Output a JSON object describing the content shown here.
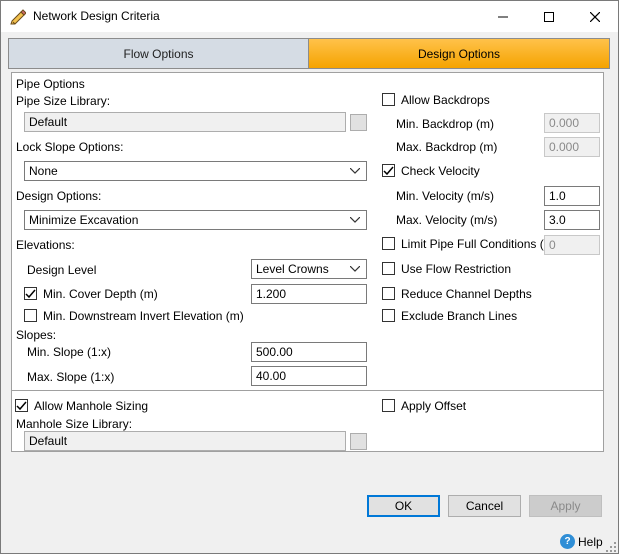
{
  "window": {
    "title": "Network Design Criteria"
  },
  "tabs": {
    "flow": "Flow Options",
    "design": "Design Options",
    "active": "Design Options"
  },
  "pipe_options": {
    "section_label": "Pipe Options",
    "size_library_label": "Pipe Size Library:",
    "size_library_value": "Default",
    "lock_slope_label": "Lock Slope Options:",
    "lock_slope_value": "None",
    "design_options_label": "Design Options:",
    "design_options_value": "Minimize Excavation",
    "elevations_label": "Elevations:",
    "design_level_label": "Design Level",
    "design_level_value": "Level Crowns",
    "min_cover_label": "Min. Cover Depth (m)",
    "min_cover_checked": true,
    "min_cover_value": "1.200",
    "min_ds_invert_label": "Min. Downstream Invert Elevation (m)",
    "min_ds_invert_checked": false,
    "slopes_label": "Slopes:",
    "min_slope_label": "Min. Slope (1:x)",
    "min_slope_value": "500.00",
    "max_slope_label": "Max. Slope (1:x)",
    "max_slope_value": "40.00"
  },
  "right_options": {
    "allow_backdrops_label": "Allow Backdrops",
    "allow_backdrops_checked": false,
    "min_backdrop_label": "Min. Backdrop (m)",
    "min_backdrop_value": "0.000",
    "max_backdrop_label": "Max. Backdrop (m)",
    "max_backdrop_value": "0.000",
    "check_velocity_label": "Check Velocity",
    "check_velocity_checked": true,
    "min_velocity_label": "Min. Velocity (m/s)",
    "min_velocity_value": "1.0",
    "max_velocity_label": "Max. Velocity (m/s)",
    "max_velocity_value": "3.0",
    "limit_pipe_full_label": "Limit Pipe Full Conditions (%)",
    "limit_pipe_full_checked": false,
    "limit_pipe_full_value": "0",
    "use_flow_restriction_label": "Use Flow Restriction",
    "reduce_channel_label": "Reduce Channel Depths",
    "exclude_branch_label": "Exclude Branch Lines"
  },
  "manhole": {
    "allow_sizing_label": "Allow Manhole Sizing",
    "allow_sizing_checked": true,
    "size_library_label": "Manhole Size Library:",
    "size_library_value": "Default",
    "apply_offset_label": "Apply Offset",
    "apply_offset_checked": false
  },
  "buttons": {
    "ok": "OK",
    "cancel": "Cancel",
    "apply": "Apply",
    "help": "Help"
  },
  "colors": {
    "active_tab": "#f5a300",
    "inactive_tab": "#d5dce4",
    "default_button_border": "#0078d7"
  }
}
